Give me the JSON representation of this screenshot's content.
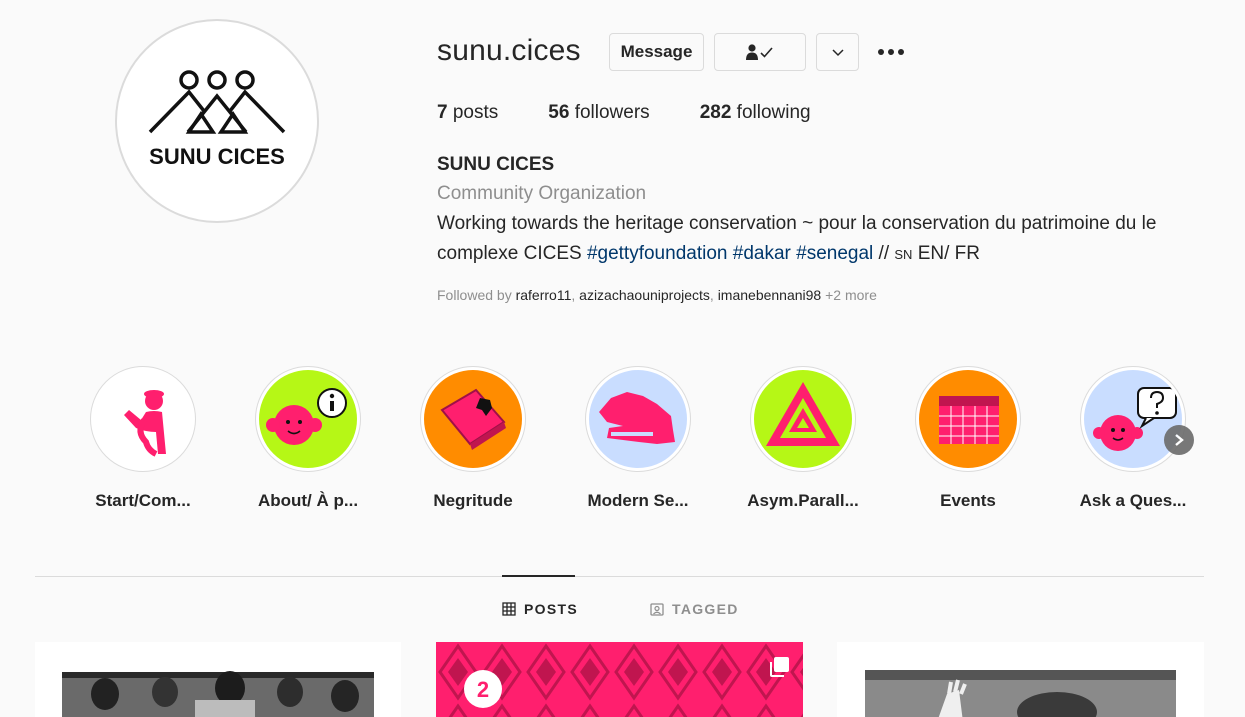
{
  "profile": {
    "username": "sunu.cices",
    "avatar_text": "SUNU CICES",
    "message_label": "Message",
    "posts_count": "7",
    "posts_label": "posts",
    "followers_count": "56",
    "followers_label": "followers",
    "following_count": "282",
    "following_label": "following",
    "display_name": "SUNU CICES",
    "category": "Community Organization",
    "bio_line1": "Working towards the heritage conservation ~ pour la conservation du patrimoine du le",
    "bio_line2_start": "complexe CICES ",
    "hashtags": [
      "#gettyfoundation",
      "#dakar",
      "#senegal"
    ],
    "bio_line2_end_sep": " // ",
    "bio_sn": "sn",
    "bio_line2_end": " EN/ FR",
    "followed_by_label": "Followed by",
    "followed_by_users": [
      "raferro11",
      "azizachaouniprojects",
      "imanebennani98"
    ],
    "followed_by_more": "+2 more"
  },
  "highlights": [
    {
      "label": "Start/Com...",
      "icon": "person-waving-icon",
      "bg": "#ffffff"
    },
    {
      "label": "About/ À p...",
      "icon": "face-info-icon",
      "bg": "#b6f716"
    },
    {
      "label": "Negritude",
      "icon": "book-africa-icon",
      "bg": "#ff8c00"
    },
    {
      "label": "Modern Se...",
      "icon": "senegal-map-icon",
      "bg": "#c9ddff"
    },
    {
      "label": "Asym.Parall...",
      "icon": "nested-triangle-icon",
      "bg": "#b6f716"
    },
    {
      "label": "Events",
      "icon": "calendar-icon",
      "bg": "#ff8c00"
    },
    {
      "label": "Ask a Ques...",
      "icon": "face-question-icon",
      "bg": "#c9ddff"
    }
  ],
  "tabs": {
    "posts": "POSTS",
    "tagged": "TAGGED"
  },
  "grid": {
    "post2_badge": "2"
  },
  "colors": {
    "accent_pink": "#ff1f6e",
    "lime": "#b6f716",
    "orange": "#ff8c00",
    "light_blue": "#c9ddff",
    "hashtag": "#00376b"
  }
}
